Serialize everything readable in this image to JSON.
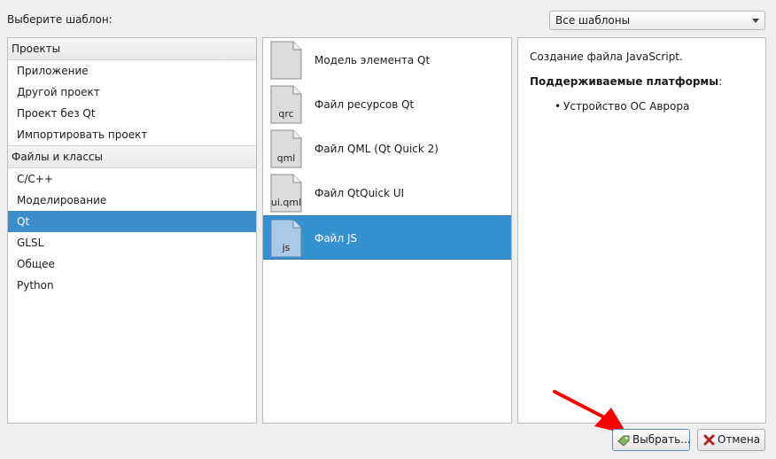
{
  "header": {
    "prompt_label": "Выберите шаблон:",
    "filter_value": "Все шаблоны"
  },
  "categories": [
    {
      "header": "Проекты",
      "items": [
        "Приложение",
        "Другой проект",
        "Проект без Qt",
        "Импортировать проект"
      ]
    },
    {
      "header": "Файлы и классы",
      "items": [
        "C/C++",
        "Моделирование",
        "Qt",
        "GLSL",
        "Общее",
        "Python"
      ]
    }
  ],
  "selected_category": "Qt",
  "templates": [
    {
      "label": "Модель элемента Qt",
      "ext": "",
      "icon": "blank-file-icon"
    },
    {
      "label": "Файл ресурсов Qt",
      "ext": "qrc",
      "icon": "qrc-file-icon"
    },
    {
      "label": "Файл QML (Qt Quick 2)",
      "ext": "qml",
      "icon": "qml-file-icon"
    },
    {
      "label": "Файл QtQuick UI",
      "ext": "ui.qml",
      "icon": "uiqml-file-icon"
    },
    {
      "label": "Файл JS",
      "ext": "js",
      "icon": "js-file-icon",
      "selected": true
    }
  ],
  "description": {
    "text": "Создание файла JavaScript.",
    "platforms_label": "Поддерживаемые платформы",
    "platforms_colon": ":",
    "platforms": [
      "Устройство ОС Аврора"
    ]
  },
  "buttons": {
    "choose": "Выбрать...",
    "cancel": "Отмена"
  },
  "colors": {
    "selection": "#3c8dc9",
    "annotation_arrow": "#ff0000"
  }
}
